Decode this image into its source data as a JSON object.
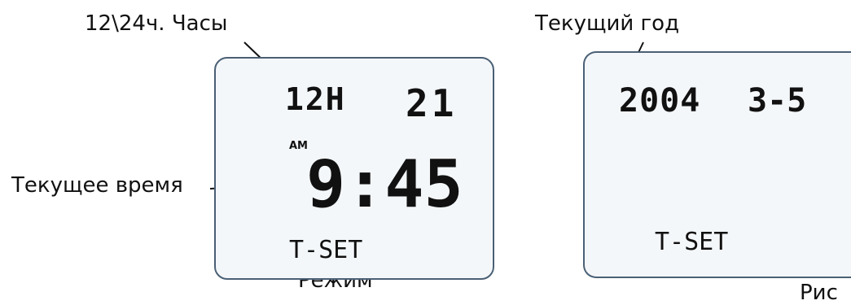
{
  "labels": {
    "clock_mode": "12\\24ч. Часы",
    "current_time": "Текущее время",
    "mode": "Режим",
    "current_year": "Текущий год",
    "figure": "Рис"
  },
  "left_screen": {
    "mode_text": "12H",
    "flash_value": "21",
    "am": "AM",
    "time": "9:45",
    "bottom": "T-SET"
  },
  "right_screen": {
    "year": "2004",
    "date": "3-5",
    "bottom": "T-SET"
  },
  "colors": {
    "accent": "#e6007e",
    "border": "#4a6075",
    "ink": "#111111"
  }
}
